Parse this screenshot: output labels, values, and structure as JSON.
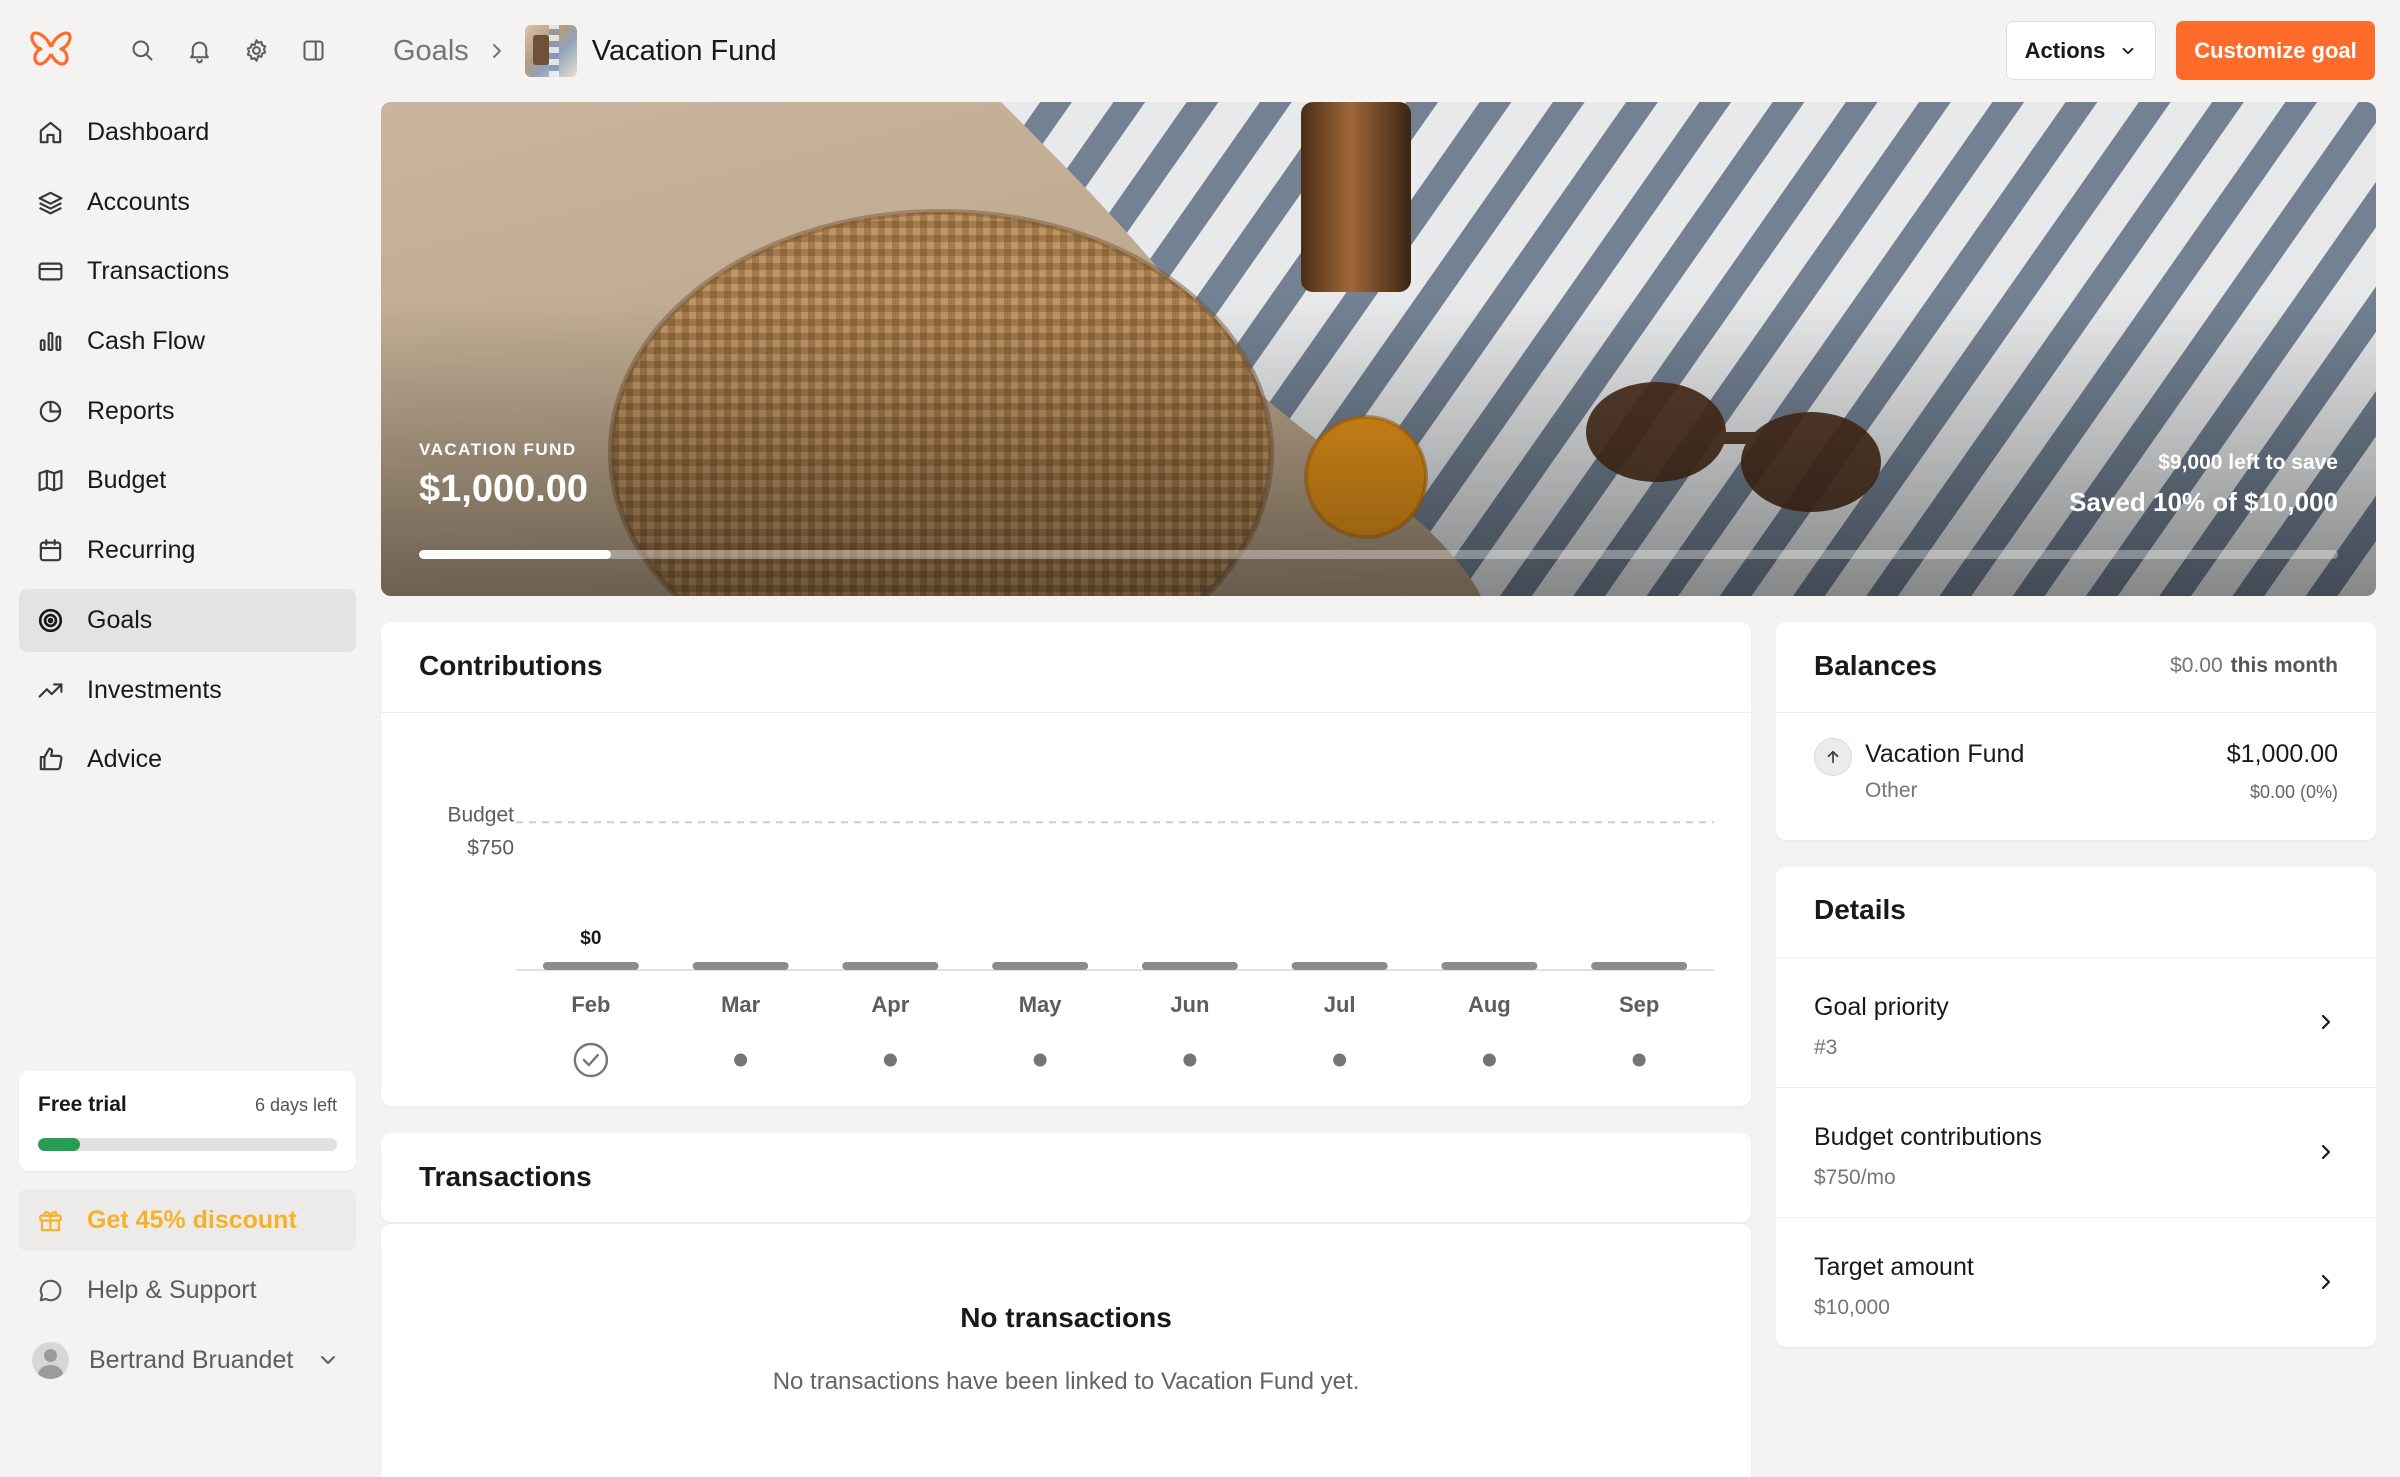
{
  "app": {
    "logo": "butterfly-logo"
  },
  "header": {
    "top_icons": [
      "search-icon",
      "bell-icon",
      "gear-icon",
      "panel-icon"
    ],
    "breadcrumb_root": "Goals",
    "title": "Vacation Fund",
    "actions_label": "Actions",
    "customize_label": "Customize goal",
    "accent_color": "#ff6b2b"
  },
  "sidebar": {
    "items": [
      {
        "label": "Dashboard",
        "icon": "home-icon"
      },
      {
        "label": "Accounts",
        "icon": "layers-icon"
      },
      {
        "label": "Transactions",
        "icon": "credit-card-icon"
      },
      {
        "label": "Cash Flow",
        "icon": "bar-chart-icon"
      },
      {
        "label": "Reports",
        "icon": "pie-chart-icon"
      },
      {
        "label": "Budget",
        "icon": "map-icon"
      },
      {
        "label": "Recurring",
        "icon": "calendar-icon"
      },
      {
        "label": "Goals",
        "icon": "target-icon",
        "active": true
      },
      {
        "label": "Investments",
        "icon": "trending-up-icon"
      },
      {
        "label": "Advice",
        "icon": "thumbs-up-icon"
      }
    ],
    "trial": {
      "title": "Free trial",
      "days_left": "6 days left",
      "progress": 0.14,
      "color": "#2a9d54"
    },
    "discount_label": "Get 45% discount",
    "discount_color": "#f5b228",
    "help_label": "Help & Support",
    "user_name": "Bertrand Bruandet"
  },
  "hero": {
    "label": "VACATION FUND",
    "amount": "$1,000.00",
    "left_to_save": "$9,000 left to save",
    "saved": "Saved 10% of $10,000",
    "progress": 0.1
  },
  "contributions": {
    "title": "Contributions",
    "budget_label": "Budget",
    "budget_value_label": "$750",
    "first_value_label": "$0"
  },
  "chart_data": {
    "type": "bar",
    "categories": [
      "Feb",
      "Mar",
      "Apr",
      "May",
      "Jun",
      "Jul",
      "Aug",
      "Sep"
    ],
    "values": [
      0,
      0,
      0,
      0,
      0,
      0,
      0,
      0
    ],
    "budget_line": 750,
    "ylim": [
      0,
      1000
    ],
    "status": [
      "done",
      "pending",
      "pending",
      "pending",
      "pending",
      "pending",
      "pending",
      "pending"
    ]
  },
  "transactions": {
    "title": "Transactions",
    "empty_title": "No transactions",
    "empty_text": "No transactions have been linked to Vacation Fund yet."
  },
  "balances": {
    "title": "Balances",
    "month_amount": "$0.00",
    "month_label": "this month",
    "account_name": "Vacation Fund",
    "account_type": "Other",
    "account_amount": "$1,000.00",
    "account_change": "$0.00 (0%)"
  },
  "details": {
    "title": "Details",
    "rows": [
      {
        "label": "Goal priority",
        "value": "#3"
      },
      {
        "label": "Budget contributions",
        "value": "$750/mo"
      },
      {
        "label": "Target amount",
        "value": "$10,000"
      }
    ]
  }
}
